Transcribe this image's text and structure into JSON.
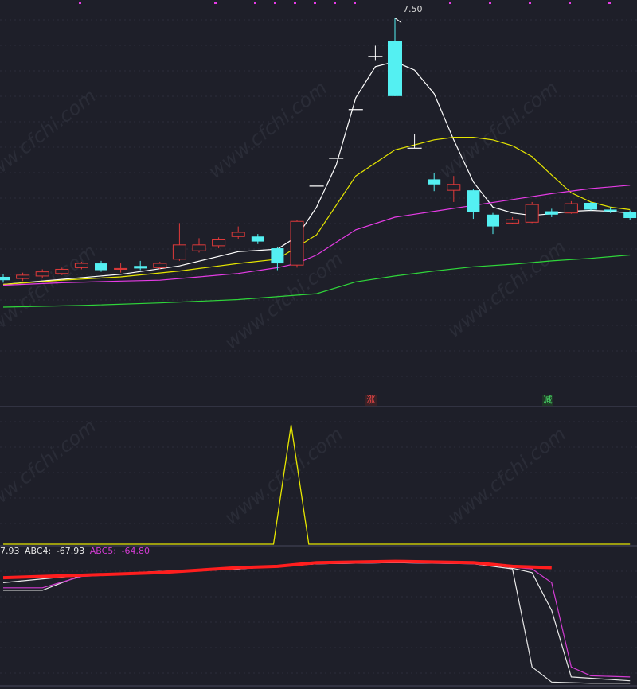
{
  "colors": {
    "background": "#1e1f29",
    "candle_up": "#e03a3a",
    "candle_down": "#54f0f2",
    "ma_white": "#ffffff",
    "ma_yellow": "#e6e600",
    "ma_magenta": "#e63ce6",
    "ma_green": "#2fd63a",
    "signal": "#e6e600",
    "abc_red": "#ff1e1e",
    "abc_white": "#e8e8e8",
    "abc_magenta": "#d23cd2"
  },
  "watermark": "www.cfchi.com",
  "peak_label": "7.50",
  "badges": {
    "zhang": "涨",
    "jian": "减"
  },
  "legend": {
    "prev_value": "7.93",
    "abc4_label": "ABC4:",
    "abc4_value": "-67.93",
    "abc5_label": "ABC5:",
    "abc5_value": "-64.80"
  },
  "chart_data": [
    {
      "type": "candlestick",
      "panel": "price",
      "ylim": [
        3.0,
        7.6
      ],
      "peak": 7.5,
      "candles": [
        {
          "o": 4.42,
          "c": 4.38,
          "h": 4.45,
          "l": 4.35
        },
        {
          "o": 4.4,
          "c": 4.44,
          "h": 4.47,
          "l": 4.37
        },
        {
          "o": 4.43,
          "c": 4.48,
          "h": 4.51,
          "l": 4.4
        },
        {
          "o": 4.46,
          "c": 4.51,
          "h": 4.53,
          "l": 4.44
        },
        {
          "o": 4.53,
          "c": 4.58,
          "h": 4.6,
          "l": 4.51
        },
        {
          "o": 4.58,
          "c": 4.5,
          "h": 4.61,
          "l": 4.48
        },
        {
          "o": 4.51,
          "c": 4.52,
          "h": 4.58,
          "l": 4.47
        },
        {
          "o": 4.55,
          "c": 4.52,
          "h": 4.61,
          "l": 4.5
        },
        {
          "o": 4.53,
          "c": 4.58,
          "h": 4.6,
          "l": 4.51
        },
        {
          "o": 4.63,
          "c": 4.8,
          "h": 5.06,
          "l": 4.61
        },
        {
          "o": 4.73,
          "c": 4.8,
          "h": 4.88,
          "l": 4.71
        },
        {
          "o": 4.79,
          "c": 4.86,
          "h": 4.89,
          "l": 4.76
        },
        {
          "o": 4.9,
          "c": 4.95,
          "h": 5.02,
          "l": 4.87
        },
        {
          "o": 4.9,
          "c": 4.84,
          "h": 4.93,
          "l": 4.81
        },
        {
          "o": 4.76,
          "c": 4.58,
          "h": 4.78,
          "l": 4.5
        },
        {
          "o": 4.56,
          "c": 5.08,
          "h": 5.1,
          "l": 4.53
        },
        {
          "o": 5.5,
          "c": 5.5,
          "h": 5.5,
          "l": 5.5
        },
        {
          "o": 5.83,
          "c": 5.83,
          "h": 5.83,
          "l": 5.83
        },
        {
          "o": 6.41,
          "c": 6.41,
          "h": 6.41,
          "l": 6.41
        },
        {
          "o": 7.04,
          "c": 7.04,
          "h": 7.17,
          "l": 6.99
        },
        {
          "o": 7.23,
          "c": 6.57,
          "h": 7.5,
          "l": 6.57
        },
        {
          "o": 5.95,
          "c": 5.95,
          "h": 6.12,
          "l": 5.95
        },
        {
          "o": 5.58,
          "c": 5.52,
          "h": 5.66,
          "l": 5.44
        },
        {
          "o": 5.45,
          "c": 5.52,
          "h": 5.62,
          "l": 5.31
        },
        {
          "o": 5.45,
          "c": 5.19,
          "h": 5.47,
          "l": 5.11
        },
        {
          "o": 5.16,
          "c": 5.02,
          "h": 5.18,
          "l": 4.93
        },
        {
          "o": 5.06,
          "c": 5.1,
          "h": 5.13,
          "l": 5.05
        },
        {
          "o": 5.07,
          "c": 5.28,
          "h": 5.31,
          "l": 5.06
        },
        {
          "o": 5.2,
          "c": 5.16,
          "h": 5.23,
          "l": 5.13
        },
        {
          "o": 5.18,
          "c": 5.29,
          "h": 5.32,
          "l": 5.17
        },
        {
          "o": 5.3,
          "c": 5.22,
          "h": 5.31,
          "l": 5.21
        },
        {
          "o": 5.22,
          "c": 5.2,
          "h": 5.25,
          "l": 5.18
        },
        {
          "o": 5.19,
          "c": 5.12,
          "h": 5.21,
          "l": 5.1
        }
      ],
      "series": [
        {
          "color_key": "ma_white",
          "points": [
            [
              0,
              4.33
            ],
            [
              3,
              4.39
            ],
            [
              6,
              4.45
            ],
            [
              9,
              4.55
            ],
            [
              12,
              4.72
            ],
            [
              14,
              4.75
            ],
            [
              15,
              4.9
            ],
            [
              16,
              5.25
            ],
            [
              17,
              5.75
            ],
            [
              18,
              6.55
            ],
            [
              19,
              6.92
            ],
            [
              20,
              6.98
            ],
            [
              21,
              6.88
            ],
            [
              22,
              6.6
            ],
            [
              23,
              6.05
            ],
            [
              24,
              5.55
            ],
            [
              25,
              5.25
            ],
            [
              26,
              5.18
            ],
            [
              27,
              5.15
            ],
            [
              28,
              5.17
            ],
            [
              29,
              5.2
            ],
            [
              30,
              5.21
            ],
            [
              31,
              5.2
            ],
            [
              32,
              5.18
            ]
          ]
        },
        {
          "color_key": "ma_yellow",
          "points": [
            [
              0,
              4.33
            ],
            [
              3,
              4.38
            ],
            [
              6,
              4.42
            ],
            [
              9,
              4.49
            ],
            [
              12,
              4.58
            ],
            [
              14,
              4.63
            ],
            [
              16,
              4.92
            ],
            [
              18,
              5.62
            ],
            [
              20,
              5.93
            ],
            [
              22,
              6.05
            ],
            [
              23,
              6.08
            ],
            [
              24,
              6.08
            ],
            [
              25,
              6.05
            ],
            [
              26,
              5.98
            ],
            [
              27,
              5.85
            ],
            [
              28,
              5.63
            ],
            [
              29,
              5.42
            ],
            [
              30,
              5.31
            ],
            [
              31,
              5.25
            ],
            [
              32,
              5.22
            ]
          ]
        },
        {
          "color_key": "ma_magenta",
          "points": [
            [
              0,
              4.32
            ],
            [
              3,
              4.35
            ],
            [
              6,
              4.37
            ],
            [
              8,
              4.38
            ],
            [
              10,
              4.42
            ],
            [
              12,
              4.46
            ],
            [
              14,
              4.53
            ],
            [
              15,
              4.58
            ],
            [
              16,
              4.68
            ],
            [
              18,
              4.98
            ],
            [
              20,
              5.13
            ],
            [
              22,
              5.2
            ],
            [
              24,
              5.27
            ],
            [
              26,
              5.34
            ],
            [
              28,
              5.41
            ],
            [
              30,
              5.47
            ],
            [
              32,
              5.51
            ]
          ]
        },
        {
          "color_key": "ma_green",
          "points": [
            [
              0,
              4.06
            ],
            [
              4,
              4.08
            ],
            [
              8,
              4.11
            ],
            [
              12,
              4.15
            ],
            [
              16,
              4.22
            ],
            [
              18,
              4.36
            ],
            [
              20,
              4.43
            ],
            [
              22,
              4.49
            ],
            [
              24,
              4.54
            ],
            [
              26,
              4.57
            ],
            [
              28,
              4.61
            ],
            [
              30,
              4.64
            ],
            [
              32,
              4.68
            ]
          ]
        }
      ]
    },
    {
      "type": "line",
      "panel": "signal",
      "ylim": [
        0,
        1
      ],
      "series": [
        {
          "color_key": "signal",
          "points": [
            [
              0,
              0
            ],
            [
              13.8,
              0
            ],
            [
              14.7,
              1
            ],
            [
              15.6,
              0
            ],
            [
              32,
              0
            ]
          ]
        }
      ]
    },
    {
      "type": "line",
      "panel": "indicator",
      "ylim": [
        -100,
        0
      ],
      "series": [
        {
          "name": "ABC4",
          "color_key": "abc_white",
          "points": [
            [
              0,
              -24
            ],
            [
              2,
              -24
            ],
            [
              4,
              -12
            ],
            [
              8,
              -9
            ],
            [
              12,
              -7
            ],
            [
              16,
              -3
            ],
            [
              20,
              -2
            ],
            [
              24,
              -3
            ],
            [
              26,
              -7
            ],
            [
              27,
              -85
            ],
            [
              28,
              -97
            ],
            [
              30,
              -98
            ],
            [
              32,
              -98
            ]
          ]
        },
        {
          "name": "ABC5",
          "color_key": "abc_magenta",
          "points": [
            [
              0,
              -22
            ],
            [
              2,
              -22
            ],
            [
              4,
              -13
            ],
            [
              8,
              -10
            ],
            [
              12,
              -7
            ],
            [
              16,
              -3
            ],
            [
              20,
              -2
            ],
            [
              24,
              -3
            ],
            [
              27,
              -7
            ],
            [
              28,
              -18
            ],
            [
              29,
              -85
            ],
            [
              30,
              -92
            ],
            [
              32,
              -93
            ]
          ]
        },
        {
          "color_key": "abc_white",
          "points": [
            [
              0,
              -18
            ],
            [
              4,
              -12
            ],
            [
              8,
              -10
            ],
            [
              12,
              -7
            ],
            [
              16,
              -3
            ],
            [
              20,
              -2
            ],
            [
              25,
              -3
            ],
            [
              27,
              -10
            ],
            [
              28,
              -40
            ],
            [
              29,
              -93
            ],
            [
              32,
              -96
            ]
          ]
        },
        {
          "color_key": "abc_red",
          "points": [
            [
              0,
              -14
            ],
            [
              4,
              -12
            ],
            [
              8,
              -10
            ],
            [
              12,
              -6
            ],
            [
              14,
              -5
            ],
            [
              16,
              -2
            ],
            [
              20,
              -1
            ],
            [
              24,
              -2
            ],
            [
              26,
              -5
            ],
            [
              28,
              -6
            ]
          ]
        }
      ]
    }
  ]
}
